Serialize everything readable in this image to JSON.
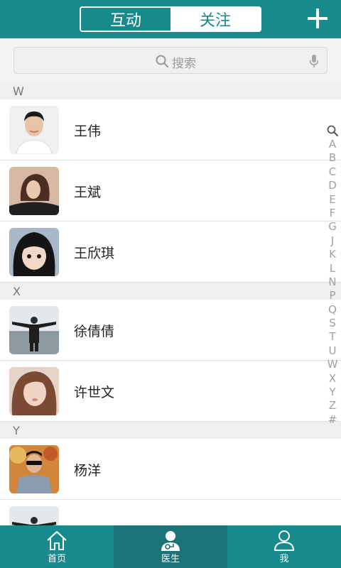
{
  "header": {
    "tabs": [
      {
        "label": "互动",
        "active": false
      },
      {
        "label": "关注",
        "active": true
      }
    ],
    "add_icon": "plus-icon"
  },
  "search": {
    "placeholder": "搜索",
    "icon": "search-icon",
    "voice_icon": "microphone-icon"
  },
  "sections": [
    {
      "letter": "W",
      "contacts": [
        {
          "name": "王伟"
        },
        {
          "name": "王斌"
        },
        {
          "name": "王欣琪"
        }
      ]
    },
    {
      "letter": "X",
      "contacts": [
        {
          "name": "徐倩倩"
        },
        {
          "name": "许世文"
        }
      ]
    },
    {
      "letter": "Y",
      "contacts": [
        {
          "name": "杨洋"
        },
        {
          "name": ""
        }
      ]
    }
  ],
  "index_bar": [
    "A",
    "B",
    "C",
    "D",
    "E",
    "F",
    "G",
    "J",
    "K",
    "L",
    "N",
    "P",
    "Q",
    "S",
    "T",
    "U",
    "W",
    "X",
    "Y",
    "Z",
    "#"
  ],
  "bottom_nav": [
    {
      "label": "首页",
      "icon": "home-icon",
      "active": false
    },
    {
      "label": "医生",
      "icon": "doctor-icon",
      "active": true
    },
    {
      "label": "我",
      "icon": "person-icon",
      "active": false
    }
  ],
  "colors": {
    "primary": "#178a8e",
    "active_nav": "#1b7377",
    "section_bg": "#efefef"
  }
}
